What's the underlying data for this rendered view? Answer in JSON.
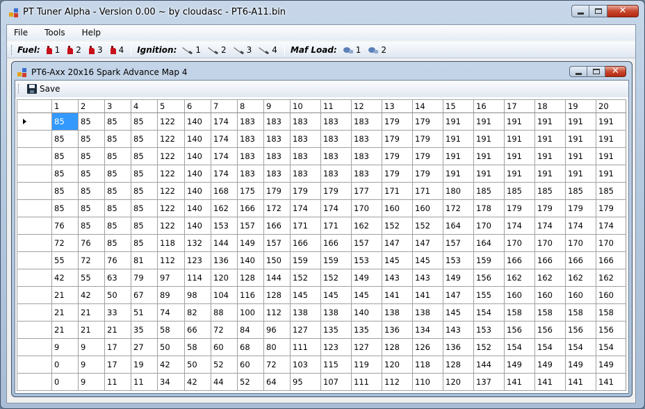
{
  "window": {
    "title": "PT Tuner Alpha - Version 0.00 ~ by cloudasc - PT6-A11.bin"
  },
  "menu": [
    "File",
    "Tools",
    "Help"
  ],
  "toolbar": {
    "fuel_label": "Fuel:",
    "fuel_buttons": [
      "1",
      "2",
      "3",
      "4"
    ],
    "ignition_label": "Ignition:",
    "ignition_buttons": [
      "1",
      "2",
      "3",
      "4"
    ],
    "maf_label": "Maf Load:",
    "maf_buttons": [
      "1",
      "2"
    ]
  },
  "child": {
    "title": "PT6-Axx 20x16 Spark Advance Map 4",
    "save_label": "Save"
  },
  "colors": {
    "selection": "#3399ff",
    "fuel_icon": "#c8101a",
    "maf_icon": "#5b7fb8"
  },
  "table": {
    "columns": [
      "1",
      "2",
      "3",
      "4",
      "5",
      "6",
      "7",
      "8",
      "9",
      "10",
      "11",
      "12",
      "13",
      "14",
      "15",
      "16",
      "17",
      "18",
      "19",
      "20"
    ],
    "selected_cell": {
      "row": 0,
      "col": 0
    },
    "rows": [
      [
        "85",
        "85",
        "85",
        "85",
        "122",
        "140",
        "174",
        "183",
        "183",
        "183",
        "183",
        "183",
        "179",
        "179",
        "191",
        "191",
        "191",
        "191",
        "191",
        "191"
      ],
      [
        "85",
        "85",
        "85",
        "85",
        "122",
        "140",
        "174",
        "183",
        "183",
        "183",
        "183",
        "183",
        "179",
        "179",
        "191",
        "191",
        "191",
        "191",
        "191",
        "191"
      ],
      [
        "85",
        "85",
        "85",
        "85",
        "122",
        "140",
        "174",
        "183",
        "183",
        "183",
        "183",
        "183",
        "179",
        "179",
        "191",
        "191",
        "191",
        "191",
        "191",
        "191"
      ],
      [
        "85",
        "85",
        "85",
        "85",
        "122",
        "140",
        "174",
        "183",
        "183",
        "183",
        "183",
        "183",
        "179",
        "179",
        "191",
        "191",
        "191",
        "191",
        "191",
        "191"
      ],
      [
        "85",
        "85",
        "85",
        "85",
        "122",
        "140",
        "168",
        "175",
        "179",
        "179",
        "179",
        "177",
        "171",
        "171",
        "180",
        "185",
        "185",
        "185",
        "185",
        "185"
      ],
      [
        "85",
        "85",
        "85",
        "85",
        "122",
        "140",
        "162",
        "166",
        "172",
        "174",
        "174",
        "170",
        "160",
        "160",
        "172",
        "178",
        "179",
        "179",
        "179",
        "179"
      ],
      [
        "76",
        "85",
        "85",
        "85",
        "122",
        "140",
        "153",
        "157",
        "166",
        "171",
        "171",
        "162",
        "152",
        "152",
        "164",
        "170",
        "174",
        "174",
        "174",
        "174"
      ],
      [
        "72",
        "76",
        "85",
        "85",
        "118",
        "132",
        "144",
        "149",
        "157",
        "166",
        "166",
        "157",
        "147",
        "147",
        "157",
        "164",
        "170",
        "170",
        "170",
        "170"
      ],
      [
        "55",
        "72",
        "76",
        "81",
        "112",
        "123",
        "136",
        "140",
        "150",
        "159",
        "159",
        "153",
        "145",
        "145",
        "153",
        "159",
        "166",
        "166",
        "166",
        "166"
      ],
      [
        "42",
        "55",
        "63",
        "79",
        "97",
        "114",
        "120",
        "128",
        "144",
        "152",
        "152",
        "149",
        "143",
        "143",
        "149",
        "156",
        "162",
        "162",
        "162",
        "162"
      ],
      [
        "21",
        "42",
        "50",
        "67",
        "89",
        "98",
        "104",
        "116",
        "128",
        "145",
        "145",
        "145",
        "141",
        "141",
        "147",
        "155",
        "160",
        "160",
        "160",
        "160"
      ],
      [
        "21",
        "21",
        "33",
        "51",
        "74",
        "82",
        "88",
        "100",
        "112",
        "138",
        "138",
        "140",
        "138",
        "138",
        "145",
        "154",
        "158",
        "158",
        "158",
        "158"
      ],
      [
        "21",
        "21",
        "21",
        "35",
        "58",
        "66",
        "72",
        "84",
        "96",
        "127",
        "135",
        "135",
        "136",
        "134",
        "143",
        "153",
        "156",
        "156",
        "156",
        "156"
      ],
      [
        "9",
        "9",
        "17",
        "27",
        "50",
        "58",
        "60",
        "68",
        "80",
        "111",
        "123",
        "127",
        "128",
        "126",
        "136",
        "152",
        "154",
        "154",
        "154",
        "154"
      ],
      [
        "0",
        "9",
        "17",
        "19",
        "42",
        "50",
        "52",
        "60",
        "72",
        "103",
        "115",
        "119",
        "120",
        "118",
        "128",
        "144",
        "149",
        "149",
        "149",
        "149"
      ],
      [
        "0",
        "9",
        "11",
        "11",
        "34",
        "42",
        "44",
        "52",
        "64",
        "95",
        "107",
        "111",
        "112",
        "110",
        "120",
        "137",
        "141",
        "141",
        "141",
        "141"
      ]
    ]
  }
}
